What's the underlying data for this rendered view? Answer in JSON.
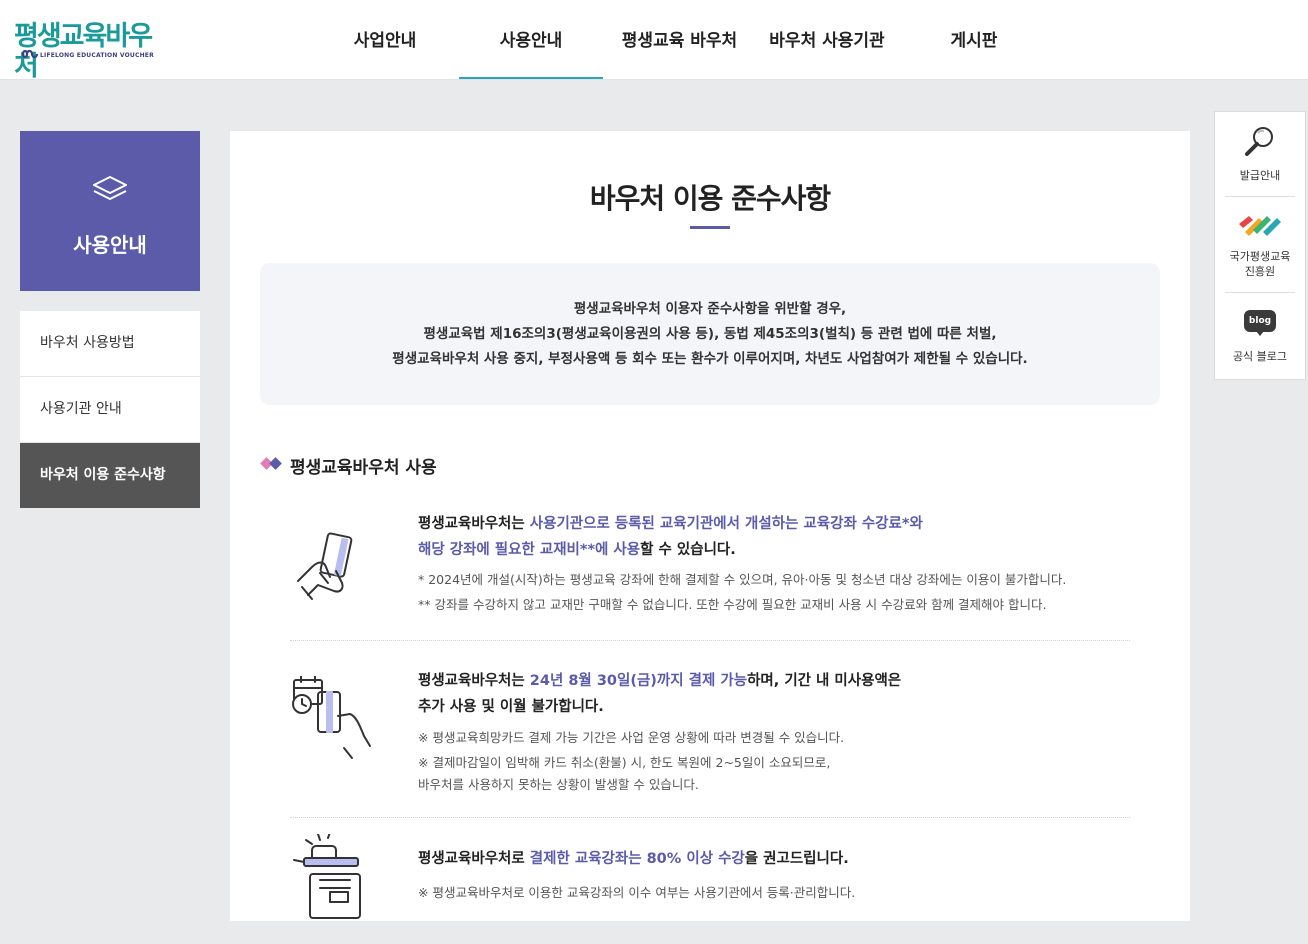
{
  "brand": {
    "name": "평생교육바우처",
    "sub": "LIFELONG EDUCATION VOUCHER"
  },
  "gnb": [
    "사업안내",
    "사용안내",
    "평생교육 바우처",
    "바우처 사용기관",
    "게시판"
  ],
  "lnb": {
    "title": "사용안내",
    "items": [
      "바우처 사용방법",
      "사용기관 안내",
      "바우처 이용 준수사항"
    ]
  },
  "main": {
    "title": "바우처 이용 준수사항",
    "notice": [
      "평생교육바우처 이용자 준수사항을 위반할 경우,",
      "평생교육법 제16조의3(평생교육이용권의 사용 등), 동법 제45조의3(벌칙) 등 관련 법에 따른 처벌,",
      "평생교육바우처 사용 중지, 부정사용액 등 회수 또는 환수가 이루어지며, 차년도 사업참여가 제한될 수 있습니다."
    ],
    "section_title": "평생교육바우처 사용",
    "items": [
      {
        "h1a": "평생교육바우처는 ",
        "h1b": "사용기관으로 등록된 교육기관에서 개설하는 교육강좌 수강료*와",
        "h2a": "해당 강좌에 필요한 교재비**에 사용",
        "h2b": "할 수 있습니다.",
        "notes": [
          "* 2024년에 개설(시작)하는 평생교육 강좌에 한해 결제할 수 있으며, 유아·아동 및 청소년 대상 강좌에는 이용이 불가합니다.",
          "** 강좌를 수강하지 않고 교재만 구매할 수 없습니다. 또한 수강에 필요한 교재비 사용 시 수강료와 함께 결제해야 합니다."
        ]
      },
      {
        "h1a": "평생교육바우처는 ",
        "h1b": "24년 8월 30일(금)까지 결제 가능",
        "h1c": "하며, 기간 내 미사용액은",
        "h2a": "추가 사용 및 이월 불가합니다.",
        "notes": [
          "※ 평생교육희망카드 결제 가능 기간은 사업 운영 상황에 따라 변경될 수 있습니다.",
          "※ 결제마감일이 임박해 카드 취소(환불) 시, 한도 복원에 2~5일이 소요되므로,",
          "    바우처를 사용하지 못하는 상황이 발생할 수 있습니다."
        ]
      },
      {
        "h1a": "평생교육바우처로 ",
        "h1b": "결제한 교육강좌는 80% 이상 수강",
        "h1c": "을 권고드립니다.",
        "notes": [
          "※ 평생교육바우처로 이용한 교육강좌의 이수 여부는 사용기관에서 등록·관리합니다."
        ]
      }
    ]
  },
  "quick": [
    "발급안내",
    "국가평생교육",
    "진흥원",
    "공식 블로그"
  ],
  "quick_blog_badge": "blog",
  "colors": {
    "accent": "#5b5ba9",
    "teal": "#2aa7b6",
    "brand": "#1a9a98"
  }
}
